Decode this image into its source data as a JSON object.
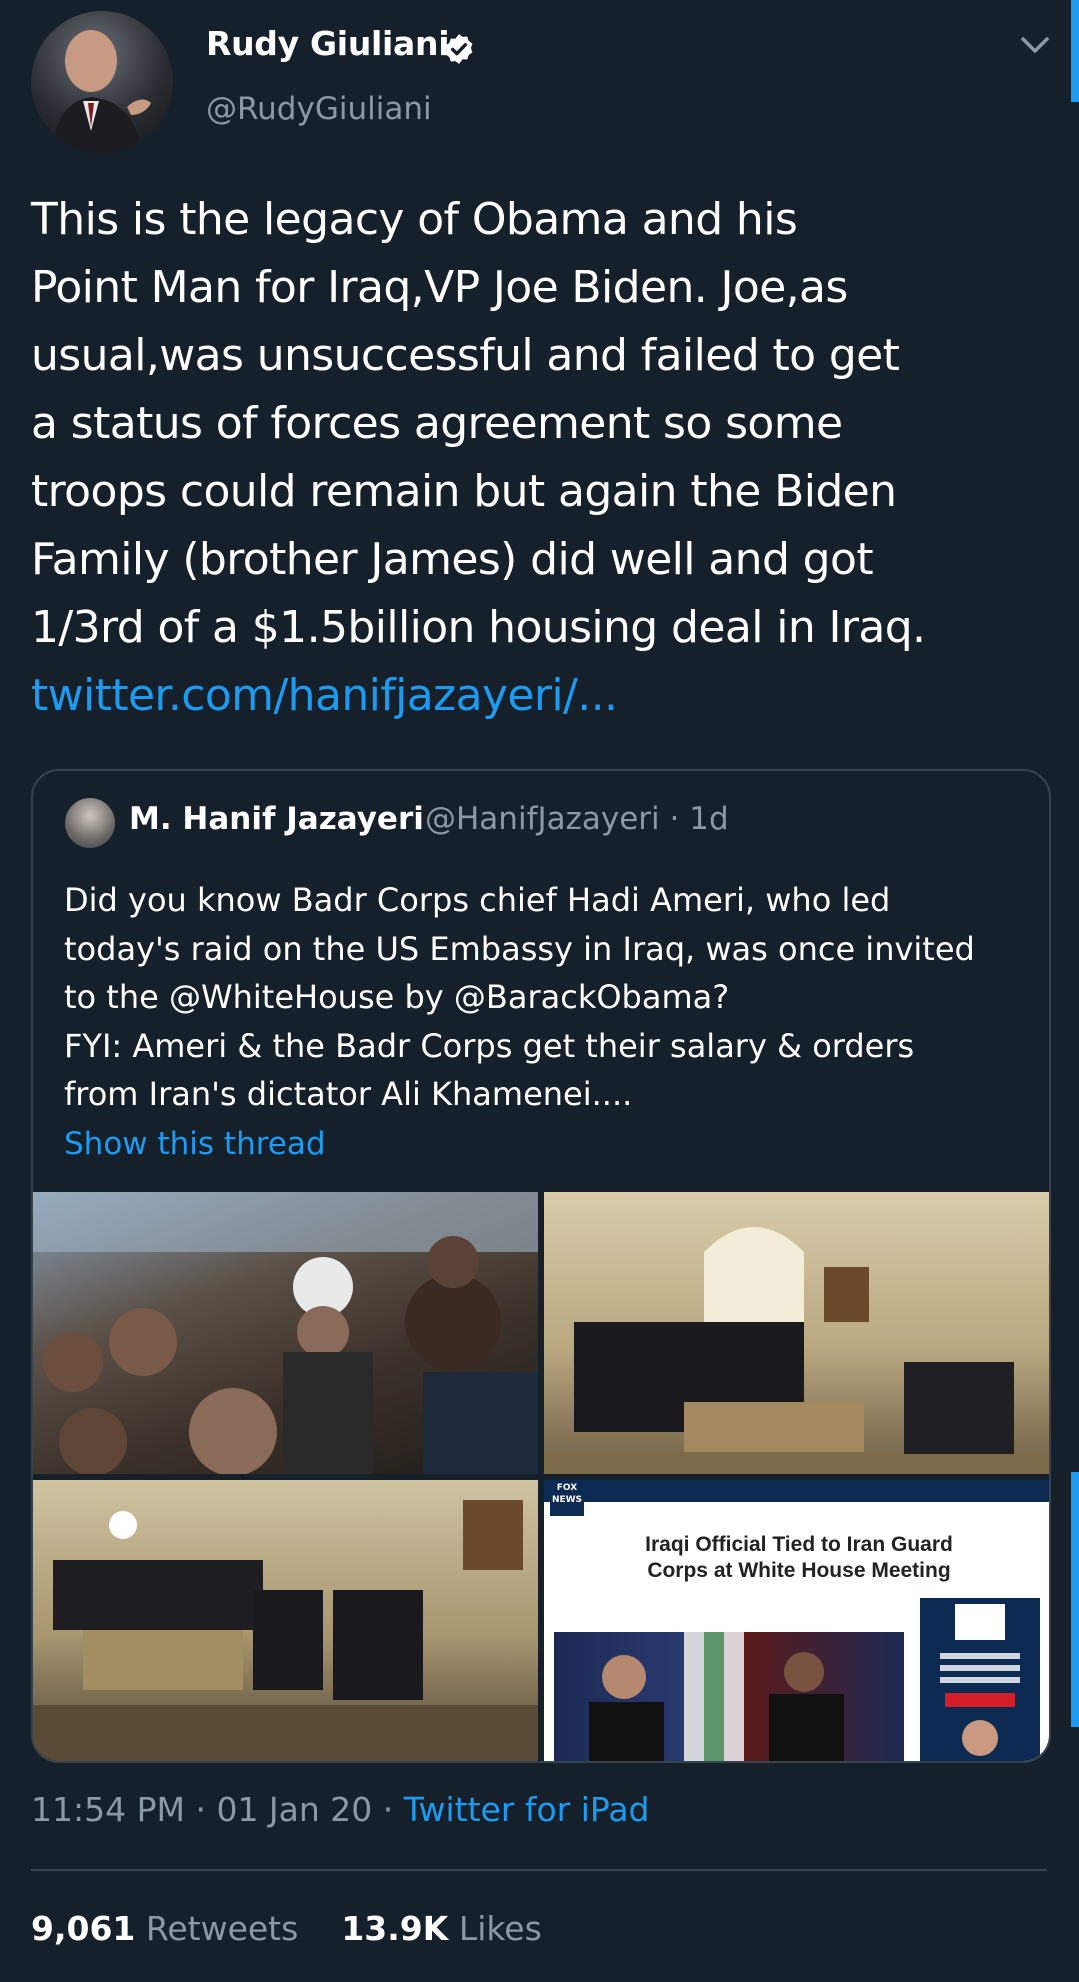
{
  "tweet": {
    "author_name": "Rudy Giuliani",
    "handle": "@RudyGiuliani",
    "text": "This is the legacy of Obama and his\nPoint Man for Iraq,VP Joe Biden. Joe,as\nusual,was unsuccessful and failed to get\na status of forces agreement so some\ntroops could remain but again the Biden\nFamily (brother James) did well and got\n1/3rd of a $1.5billion housing deal in Iraq.",
    "link": "twitter.com/hanifjazayeri/...",
    "time": "11:54 PM",
    "date": "01 Jan 20",
    "source": "Twitter for iPad",
    "retweets": "9,061",
    "retweets_label": "Retweets",
    "likes": "13.9K",
    "likes_label": "Likes"
  },
  "quoted": {
    "author_name": "M. Hanif Jazayeri",
    "handle": "@HanifJazayeri",
    "age": "1d",
    "text": "Did you know Badr Corps chief Hadi Ameri, who led\ntoday's raid on the US Embassy in Iraq, was once invited\nto the @WhiteHouse by @BarackObama?\nFYI: Ameri & the Badr Corps get their salary & orders\nfrom Iran's dictator Ali Khamenei....",
    "show_thread": "Show this thread",
    "news_headline": "Iraqi Official Tied to Iran Guard\nCorps at White House Meeting",
    "news_logo": "FOX NEWS"
  },
  "icons": {
    "verified": "verified-badge-icon",
    "caret": "chevron-down-icon"
  },
  "colors": {
    "background": "#15202b",
    "link": "#1d9bf0",
    "secondary_text": "#8b98a5",
    "border": "#38444d"
  }
}
